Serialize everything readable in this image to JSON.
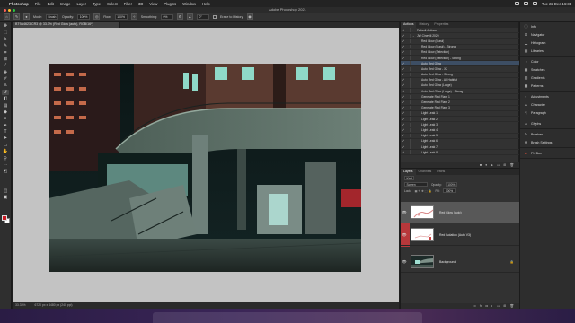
{
  "menubar": {
    "app": "Photoshop",
    "items": [
      "File",
      "Edit",
      "Image",
      "Layer",
      "Type",
      "Select",
      "Filter",
      "3D",
      "View",
      "Plugins",
      "Window",
      "Help"
    ],
    "clock": "Tue 22 Dec 16:31"
  },
  "window": {
    "title": "Adobe Photoshop 2021"
  },
  "options": {
    "mode_label": "Mode:",
    "mode_value": "Brush",
    "opacity_label": "Opacity:",
    "opacity_value": "100%",
    "flow_label": "Flow:",
    "flow_value": "100%",
    "smoothing_label": "Smoothing:",
    "smoothing_value": "0%",
    "angle_value": "0°",
    "history_label": "Erase to History"
  },
  "document": {
    "tab": "BT9A4623.CR3 @ 33.3% (Red Glow (auto), RGB/16*)",
    "zoom": "33.33%",
    "info": "6720 px x 4480 px (240 ppi)"
  },
  "actions_panel": {
    "tabs": [
      "Actions",
      "History",
      "Properties"
    ],
    "rows": [
      {
        "check": "✓",
        "twirl": "›",
        "label": "Default Actions",
        "highlight": false
      },
      {
        "check": "✓",
        "twirl": "⌄",
        "label": "JW Cinevili 2020",
        "highlight": false
      },
      {
        "check": "✓",
        "twirl": "",
        "label": "Red Glow (Mask)",
        "highlight": false
      },
      {
        "check": "✓",
        "twirl": "",
        "label": "Red Glow (Mask) - Strong",
        "highlight": false
      },
      {
        "check": "✓",
        "twirl": "",
        "label": "Red Glow (Selection)",
        "highlight": false
      },
      {
        "check": "✓",
        "twirl": "",
        "label": "Red Glow (Selection) - Strong",
        "highlight": false
      },
      {
        "check": "✓",
        "twirl": "",
        "label": "Auto Red Glow",
        "highlight": true
      },
      {
        "check": "✓",
        "twirl": "",
        "label": "Auto Red Glow - X2",
        "highlight": false
      },
      {
        "check": "✓",
        "twirl": "",
        "label": "Auto Red Glow - Strong",
        "highlight": false
      },
      {
        "check": "✓",
        "twirl": "",
        "label": "Auto Red Glow - All Habitat",
        "highlight": false
      },
      {
        "check": "✓",
        "twirl": "",
        "label": "Auto Red Glow (Large)",
        "highlight": false
      },
      {
        "check": "✓",
        "twirl": "",
        "label": "Auto Red Glow (Large) - Strong",
        "highlight": false
      },
      {
        "check": "✓",
        "twirl": "",
        "label": "Generate Red Flare 1",
        "highlight": false
      },
      {
        "check": "✓",
        "twirl": "",
        "label": "Generate Red Flare 2",
        "highlight": false
      },
      {
        "check": "✓",
        "twirl": "",
        "label": "Generate Red Flare 3",
        "highlight": false
      },
      {
        "check": "✓",
        "twirl": "",
        "label": "Light Leak 1",
        "highlight": false
      },
      {
        "check": "✓",
        "twirl": "",
        "label": "Light Leak 2",
        "highlight": false
      },
      {
        "check": "✓",
        "twirl": "",
        "label": "Light Leak 3",
        "highlight": false
      },
      {
        "check": "✓",
        "twirl": "",
        "label": "Light Leak 4",
        "highlight": false
      },
      {
        "check": "✓",
        "twirl": "",
        "label": "Light Leak 5",
        "highlight": false
      },
      {
        "check": "✓",
        "twirl": "",
        "label": "Light Leak 6",
        "highlight": false
      },
      {
        "check": "✓",
        "twirl": "",
        "label": "Light Leak 7",
        "highlight": false
      },
      {
        "check": "✓",
        "twirl": "",
        "label": "Light Leak 8",
        "highlight": false
      }
    ]
  },
  "layers_panel": {
    "tabs": [
      "Layers",
      "Channels",
      "Paths"
    ],
    "kind": "Kind",
    "blend_mode": "Screen",
    "opacity_label": "Opacity:",
    "opacity_value": "100%",
    "lock_label": "Lock:",
    "fill_label": "Fill:",
    "fill_value": "100%",
    "layers": [
      {
        "name": "Red Glow (auto)",
        "selected": true
      },
      {
        "name": "Red Isolation (Auto V3)",
        "selected": false
      },
      {
        "name": "Background",
        "selected": false
      }
    ]
  },
  "dock_panels": [
    {
      "group": 1,
      "items": [
        {
          "icon": "info-icon",
          "label": "Info"
        },
        {
          "icon": "navigator-icon",
          "label": "Navigator"
        },
        {
          "icon": "histogram-icon",
          "label": "Histogram"
        },
        {
          "icon": "libraries-icon",
          "label": "Libraries"
        }
      ]
    },
    {
      "group": 2,
      "items": [
        {
          "icon": "color-icon",
          "label": "Color"
        },
        {
          "icon": "swatches-icon",
          "label": "Swatches"
        },
        {
          "icon": "gradients-icon",
          "label": "Gradients"
        },
        {
          "icon": "patterns-icon",
          "label": "Patterns"
        }
      ]
    },
    {
      "group": 3,
      "items": [
        {
          "icon": "adjustments-icon",
          "label": "Adjustments"
        },
        {
          "icon": "character-icon",
          "label": "Character"
        },
        {
          "icon": "paragraph-icon",
          "label": "Paragraph"
        }
      ]
    },
    {
      "group": 4,
      "items": [
        {
          "icon": "glyphs-icon",
          "label": "Glyphs"
        }
      ]
    },
    {
      "group": 5,
      "items": [
        {
          "icon": "brushes-icon",
          "label": "Brushes"
        },
        {
          "icon": "brush-settings-icon",
          "label": "Brush Settings"
        }
      ]
    },
    {
      "group": 6,
      "items": [
        {
          "icon": "fx-box-icon",
          "label": "FX Box"
        }
      ]
    }
  ],
  "colors": {
    "foreground": "#c81b24",
    "background": "#ffffff",
    "highlight_row": "#3d4e64",
    "layer_red_marker": "#b8383b"
  }
}
